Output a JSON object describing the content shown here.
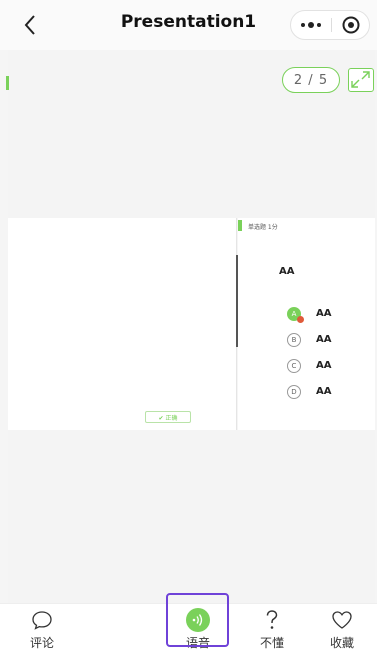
{
  "header": {
    "title": "Presentation1",
    "more_icon": "more-dots-icon",
    "target_icon": "target-icon",
    "back_icon": "chevron-left-icon"
  },
  "slide": {
    "page_indicator": "2 / 5",
    "confirm_label": "✔ 正确"
  },
  "question": {
    "type_label": "单选题 1分",
    "text": "AA",
    "options": [
      {
        "letter": "A",
        "label": "AA",
        "selected": true
      },
      {
        "letter": "B",
        "label": "AA",
        "selected": false
      },
      {
        "letter": "C",
        "label": "AA",
        "selected": false
      },
      {
        "letter": "D",
        "label": "AA",
        "selected": false
      }
    ]
  },
  "bottom_nav": {
    "items": [
      {
        "label": "评论",
        "icon": "comment-icon"
      },
      {
        "label": "语音",
        "icon": "voice-icon",
        "highlighted": true
      },
      {
        "label": "不懂",
        "icon": "question-icon"
      },
      {
        "label": "收藏",
        "icon": "heart-icon"
      }
    ]
  },
  "colors": {
    "accent": "#7ad15a",
    "highlight_border": "#6f42d8",
    "selected_dot": "#e05a3a"
  }
}
